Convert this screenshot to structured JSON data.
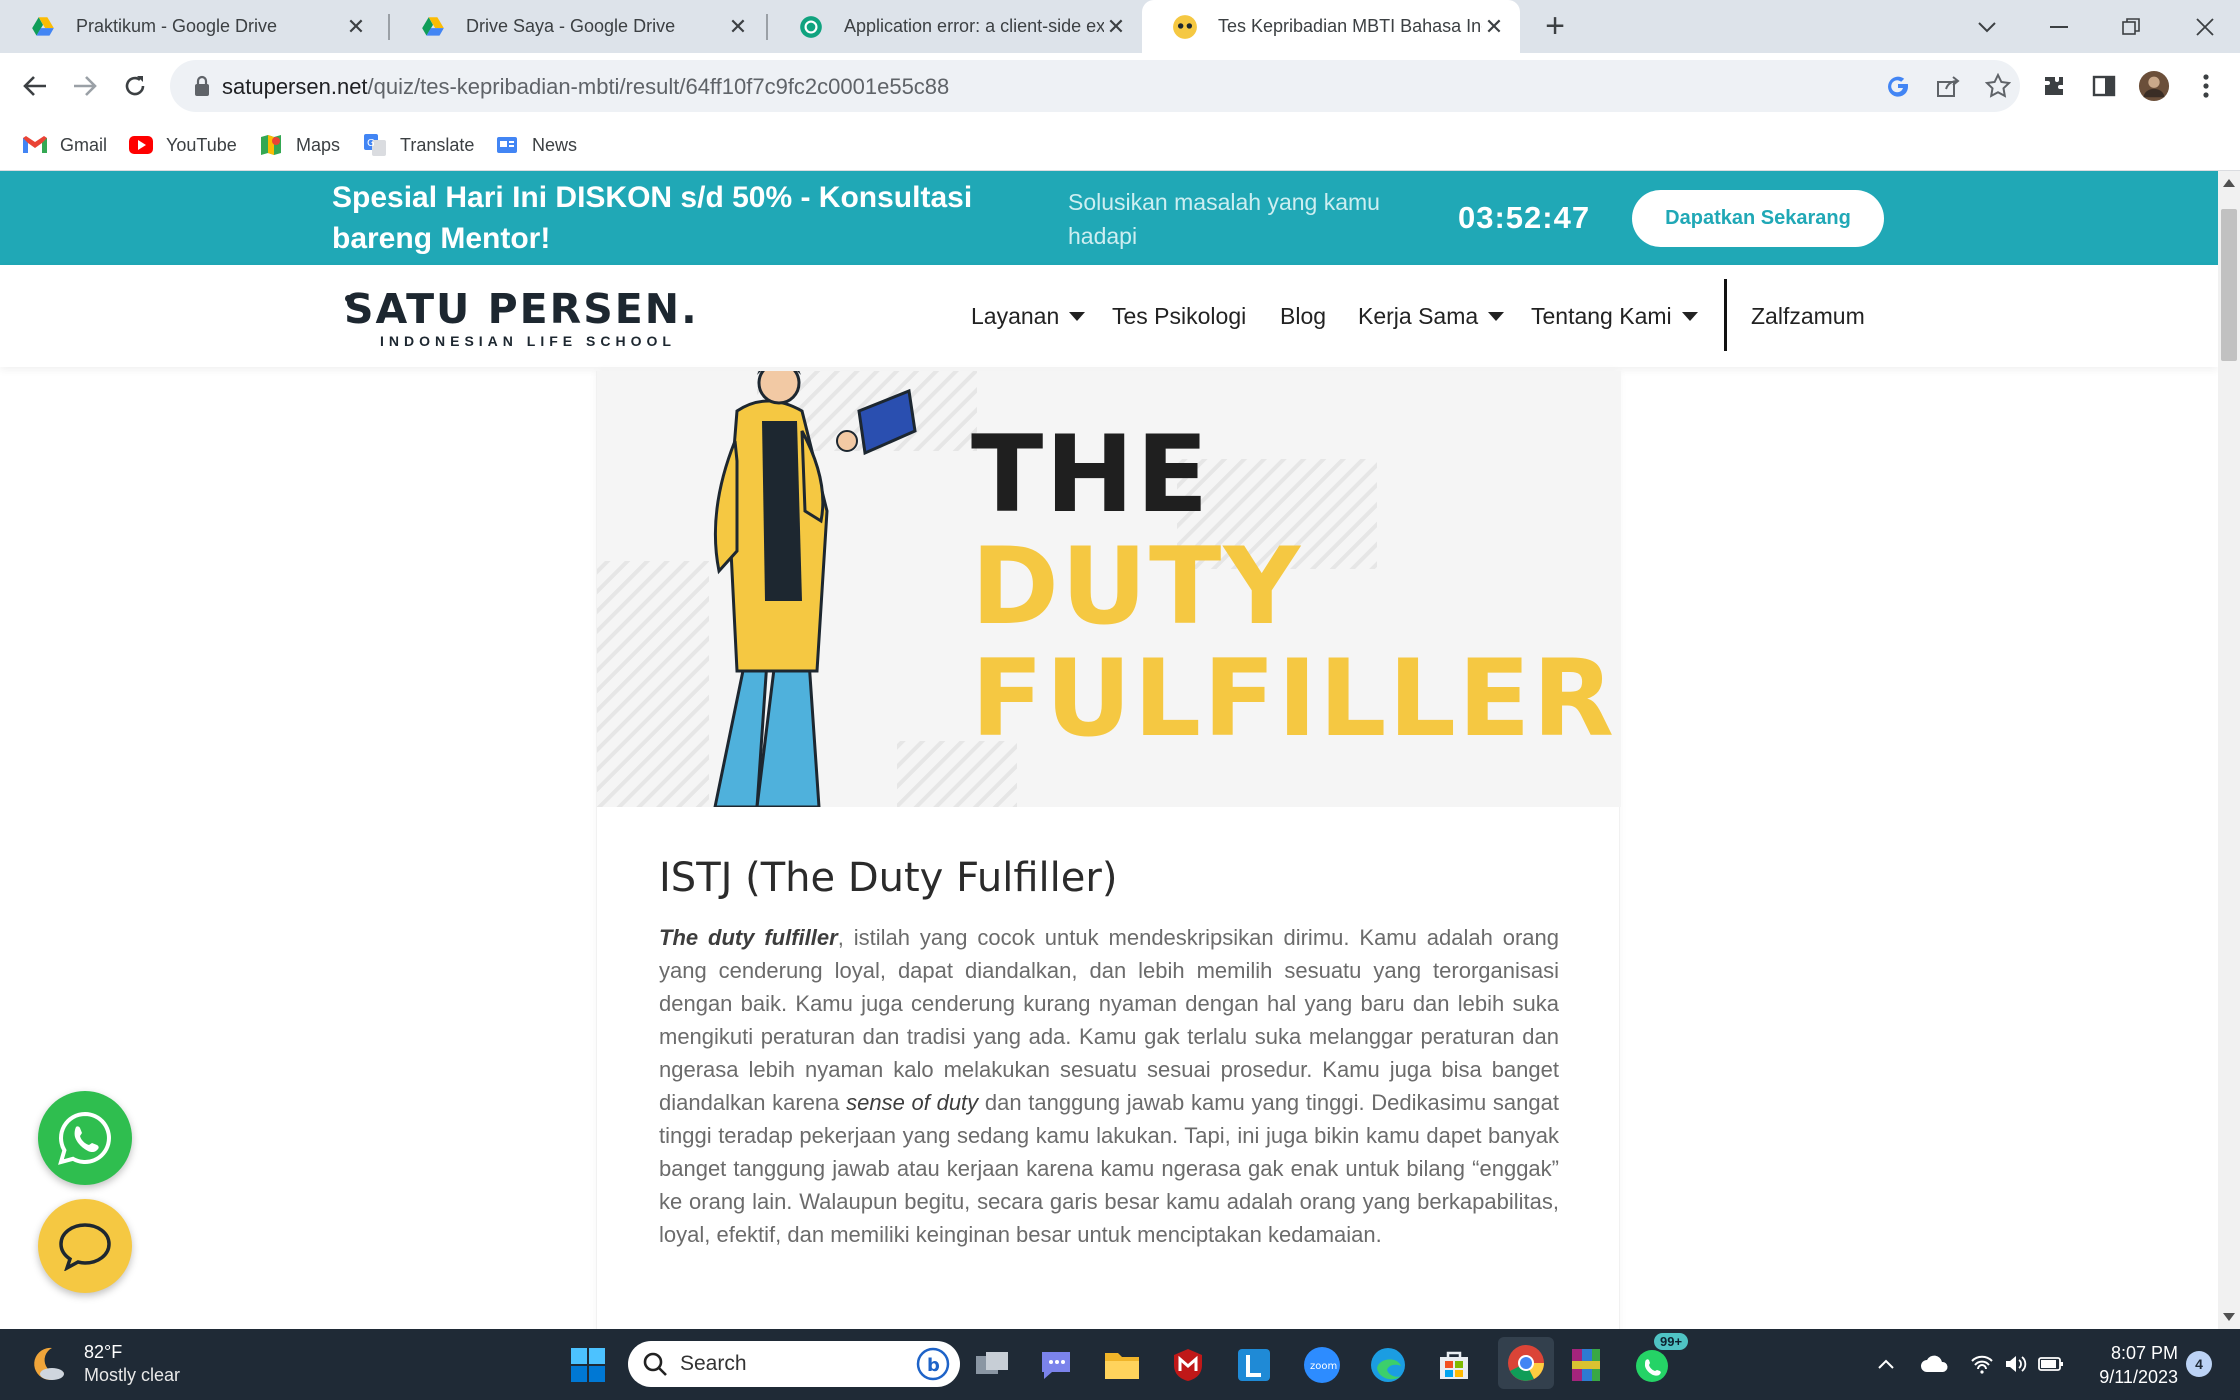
{
  "browser": {
    "tabs": [
      {
        "title": "Praktikum - Google Drive",
        "favicon": "google-drive-icon",
        "active": false
      },
      {
        "title": "Drive Saya - Google Drive",
        "favicon": "google-drive-icon",
        "active": false
      },
      {
        "title": "Application error: a client-side exception has occurred",
        "favicon": "openai-icon",
        "active": false
      },
      {
        "title": "Tes Kepribadian MBTI Bahasa Indonesia",
        "favicon": "satupersen-icon",
        "active": true
      }
    ],
    "url_host": "satupersen.net",
    "url_path": "/quiz/tes-kepribadian-mbti/result/64ff10f7c9fc2c0001e55c88",
    "bookmarks": [
      {
        "label": "Gmail",
        "icon": "gmail-icon"
      },
      {
        "label": "YouTube",
        "icon": "youtube-icon"
      },
      {
        "label": "Maps",
        "icon": "maps-icon"
      },
      {
        "label": "Translate",
        "icon": "translate-icon"
      },
      {
        "label": "News",
        "icon": "news-icon"
      }
    ]
  },
  "promo": {
    "headline": "Spesial Hari Ini DISKON s/d 50% - Konsultasi bareng Mentor!",
    "subtext": "Solusikan masalah yang kamu hadapi",
    "countdown": "03:52:47",
    "cta": "Dapatkan Sekarang",
    "color": "#20a8b6"
  },
  "site": {
    "logo_text": "SATU PERSEN.",
    "logo_tagline": "INDONESIAN LIFE SCHOOL",
    "nav": [
      {
        "label": "Layanan",
        "dropdown": true
      },
      {
        "label": "Tes Psikologi",
        "dropdown": false
      },
      {
        "label": "Blog",
        "dropdown": false
      },
      {
        "label": "Kerja Sama",
        "dropdown": true
      },
      {
        "label": "Tentang Kami",
        "dropdown": true
      }
    ],
    "user": "Zalfzamum"
  },
  "result": {
    "hero_line1": "THE",
    "hero_line2": "DUTY",
    "hero_line3": "FULFILLER",
    "hero_accent": "#f5c842",
    "title": "ISTJ (The Duty Fulfiller)",
    "para_lead": "The duty fulfiller",
    "para_a": ", istilah yang cocok untuk mendeskripsikan dirimu. Kamu adalah orang yang cenderung loyal, dapat diandalkan, dan lebih memilih sesuatu yang terorganisasi dengan baik. Kamu juga cenderung kurang nyaman dengan hal yang baru dan lebih suka mengikuti peraturan dan tradisi yang ada. Kamu gak terlalu suka melanggar peraturan dan ngerasa lebih nyaman kalo melakukan sesuatu sesuai prosedur. Kamu juga bisa banget diandalkan karena ",
    "para_em": "sense of duty",
    "para_b": " dan tanggung jawab kamu yang tinggi. Dedikasimu sangat tinggi teradap pekerjaan yang sedang kamu lakukan. Tapi, ini juga bikin kamu dapet banyak banget tanggung jawab atau kerjaan karena kamu ngerasa gak enak untuk bilang “enggak” ke orang lain. Walaupun begitu, secara garis besar kamu adalah orang yang berkapabilitas, loyal, efektif, dan memiliki keinginan besar untuk menciptakan kedamaian."
  },
  "taskbar": {
    "temperature": "82°F",
    "weather": "Mostly clear",
    "search_placeholder": "Search",
    "whatsapp_badge": "99+",
    "time": "8:07 PM",
    "date": "9/11/2023",
    "notifications": "4"
  }
}
